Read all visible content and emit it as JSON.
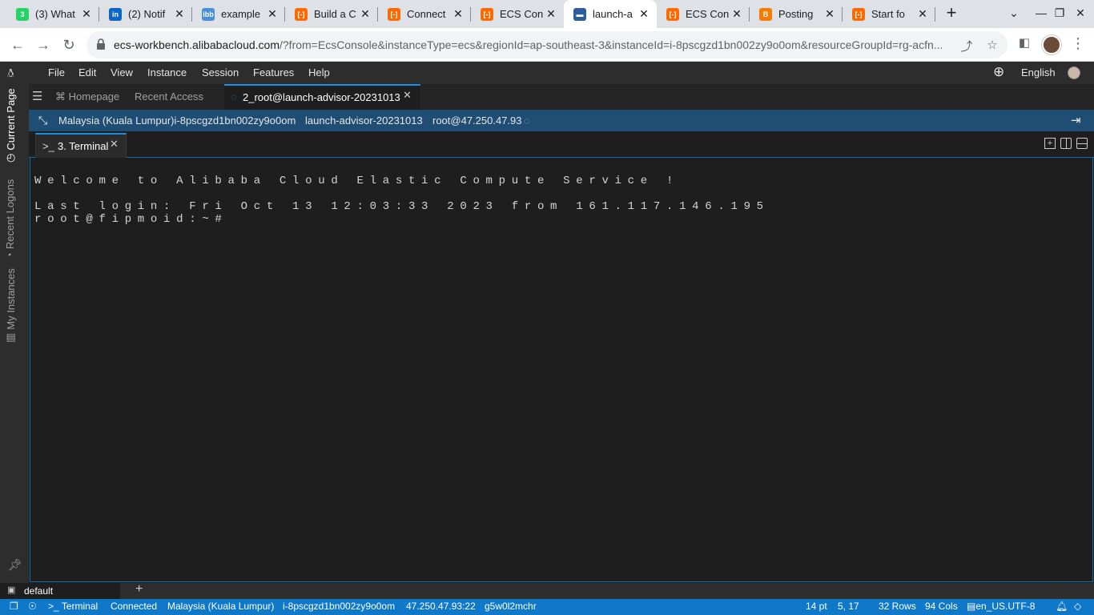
{
  "browser": {
    "tabs": [
      {
        "label": "(3) What",
        "icon": "whatsapp-icon",
        "color": "#25d366",
        "glyph": "3"
      },
      {
        "label": "(2) Notif",
        "icon": "linkedin-icon",
        "color": "#0a66c2",
        "glyph": "in"
      },
      {
        "label": "example",
        "icon": "ibb-icon",
        "color": "#4a90d9",
        "glyph": "ibb"
      },
      {
        "label": "Build a C",
        "icon": "alibaba-cloud-icon",
        "color": "#ff6a00",
        "glyph": "[-]"
      },
      {
        "label": "Connect",
        "icon": "alibaba-cloud-icon",
        "color": "#ff6a00",
        "glyph": "[-]"
      },
      {
        "label": "ECS Con",
        "icon": "alibaba-cloud-icon",
        "color": "#ff6a00",
        "glyph": "[-]"
      },
      {
        "label": "launch-a",
        "icon": "workbench-icon",
        "color": "#2d5d9b",
        "glyph": "▬"
      },
      {
        "label": "ECS Con",
        "icon": "alibaba-cloud-icon",
        "color": "#ff6a00",
        "glyph": "[-]"
      },
      {
        "label": "Posting",
        "icon": "blogger-icon",
        "color": "#f57c00",
        "glyph": "B"
      },
      {
        "label": "Start fo",
        "icon": "alibaba-cloud-icon",
        "color": "#ff6a00",
        "glyph": "[-]"
      }
    ],
    "active_tab_index": 6,
    "url_host": "ecs-workbench.alibabacloud.com",
    "url_rest": "/?from=EcsConsole&instanceType=ecs&regionId=ap-southeast-3&instanceId=i-8pscgzd1bn002zy9o0om&resourceGroupId=rg-acfn..."
  },
  "menu": {
    "items": [
      "File",
      "Edit",
      "View",
      "Instance",
      "Session",
      "Features",
      "Help"
    ],
    "language": "English"
  },
  "rail": {
    "current_page": "Current Page",
    "recent_logons": "Recent Logons",
    "my_instances": "My Instances"
  },
  "session_tabs": {
    "homepage": "Homepage",
    "recent_access": "Recent Access",
    "active_session": "2_root@launch-advisor-20231013"
  },
  "info": {
    "region_instance": "Malaysia (Kuala Lumpur)i-8pscgzd1bn002zy9o0om",
    "instance_name": "launch-advisor-20231013",
    "user_host": "root@47.250.47.93"
  },
  "terminal": {
    "tab_label": "3. Terminal",
    "lines": [
      "Welcome to Alibaba Cloud Elastic Compute Service !",
      "Last login: Fri Oct 13 12:03:33 2023 from 161.117.146.195",
      "root@fipmoid:~#"
    ]
  },
  "bottom": {
    "profile": "default"
  },
  "status": {
    "terminal": "Terminal",
    "connection": "Connected",
    "region": "Malaysia (Kuala Lumpur)",
    "instance_id": "i-8pscgzd1bn002zy9o0om",
    "address": "47.250.47.93:22",
    "session_code": "g5w0l2mchr",
    "font_size": "14 pt",
    "cursor": "5, 17",
    "rows": "32 Rows",
    "cols": "94 Cols",
    "locale": "en_US.UTF-8"
  },
  "colors": {
    "accent": "#1a8fe3",
    "status_bar": "#0f78c9",
    "info_bar": "#1f4d73",
    "terminal_bg": "#1e1e1e"
  }
}
